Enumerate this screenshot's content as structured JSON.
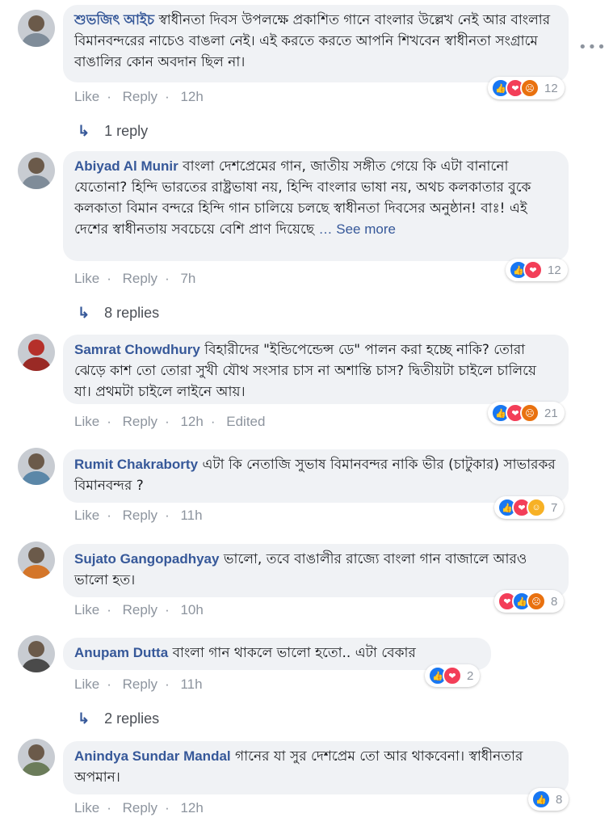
{
  "comments": [
    {
      "author": "শুভজিৎ আইচ",
      "text": "স্বাধীনতা দিবস উপলক্ষে প্রকাশিত গানে বাংলার উল্লেখ নেই আর বাংলার বিমানবন্দরের নাচেও বাঙলা নেই। এই করতে করতে আপনি শিখবেন স্বাধীনতা সংগ্রামে বাঙালির কোন অবদান ছিল না।",
      "see_more": "",
      "like": "Like",
      "reply": "Reply",
      "time": "12h",
      "edited": "",
      "reactions": [
        "like-icon",
        "love-icon",
        "angry-icon"
      ],
      "reaction_count": "12",
      "replies": "1 reply"
    },
    {
      "author": "Abiyad Al Munir",
      "text": "বাংলা দেশপ্রেমের গান, জাতীয় সঙ্গীত গেয়ে কি এটা বানানো যেতোনা? হিন্দি ভারতের রাষ্ট্রভাষা নয়, হিন্দি বাংলার ভাষা নয়, অথচ কলকাতার বুকে কলকাতা বিমান বন্দরে হিন্দি গান চালিয়ে চলছে স্বাধীনতা দিবসের অনুষ্ঠান! বাঃ! এই দেশের স্বাধীনতায় সবচেয়ে বেশি প্রাণ দিয়েছে",
      "see_more": "… See more",
      "like": "Like",
      "reply": "Reply",
      "time": "7h",
      "edited": "",
      "reactions": [
        "like-icon",
        "love-icon"
      ],
      "reaction_count": "12",
      "replies": "8 replies"
    },
    {
      "author": "Samrat Chowdhury",
      "text": "বিহারীদের \"ইন্ডিপেন্ডেন্স ডে\" পালন করা হচ্ছে নাকি? তোরা ঝেড়ে কাশ তো তোরা সুখী যৌথ সংসার চাস না অশান্তি চাস? দ্বিতীয়টা চাইলে চালিয়ে যা। প্রথমটা চাইলে লাইনে আয়।",
      "see_more": "",
      "like": "Like",
      "reply": "Reply",
      "time": "12h",
      "edited": "Edited",
      "reactions": [
        "like-icon",
        "love-icon",
        "angry-icon"
      ],
      "reaction_count": "21",
      "replies": ""
    },
    {
      "author": "Rumit Chakraborty",
      "text": "এটা কি নেতাজি সুভাষ বিমানবন্দর নাকি ভীর (চাটুকার) সাভারকর বিমানবন্দর ?",
      "see_more": "",
      "like": "Like",
      "reply": "Reply",
      "time": "11h",
      "edited": "",
      "reactions": [
        "like-icon",
        "love-icon",
        "haha-icon"
      ],
      "reaction_count": "7",
      "replies": ""
    },
    {
      "author": "Sujato Gangopadhyay",
      "text": "ভালো, তবে বাঙালীর রাজ্যে বাংলা গান বাজালে আরও ভালো হত।",
      "see_more": "",
      "like": "Like",
      "reply": "Reply",
      "time": "10h",
      "edited": "",
      "reactions": [
        "love-icon",
        "like-icon",
        "angry-icon"
      ],
      "reaction_count": "8",
      "replies": ""
    },
    {
      "author": "Anupam Dutta",
      "text": "বাংলা গান থাকলে ভালো হতো.. এটা বেকার",
      "see_more": "",
      "like": "Like",
      "reply": "Reply",
      "time": "11h",
      "edited": "",
      "reactions": [
        "like-icon",
        "love-icon"
      ],
      "reaction_count": "2",
      "replies": "2 replies"
    },
    {
      "author": "Anindya Sundar Mandal",
      "text": "গানের যা সুর দেশপ্রেম তো আর থাকবেনা। স্বাধীনতার অপমান।",
      "see_more": "",
      "like": "Like",
      "reply": "Reply",
      "time": "12h",
      "edited": "",
      "reactions": [
        "like-icon"
      ],
      "reaction_count": "8",
      "replies": ""
    }
  ],
  "options_label": "•••",
  "colors": {
    "link": "#365899",
    "meta": "#8d949e",
    "bubble": "#f0f2f5",
    "like": "#1877f2",
    "love": "#f33e58",
    "angry": "#e9710f",
    "haha": "#f7b125"
  }
}
